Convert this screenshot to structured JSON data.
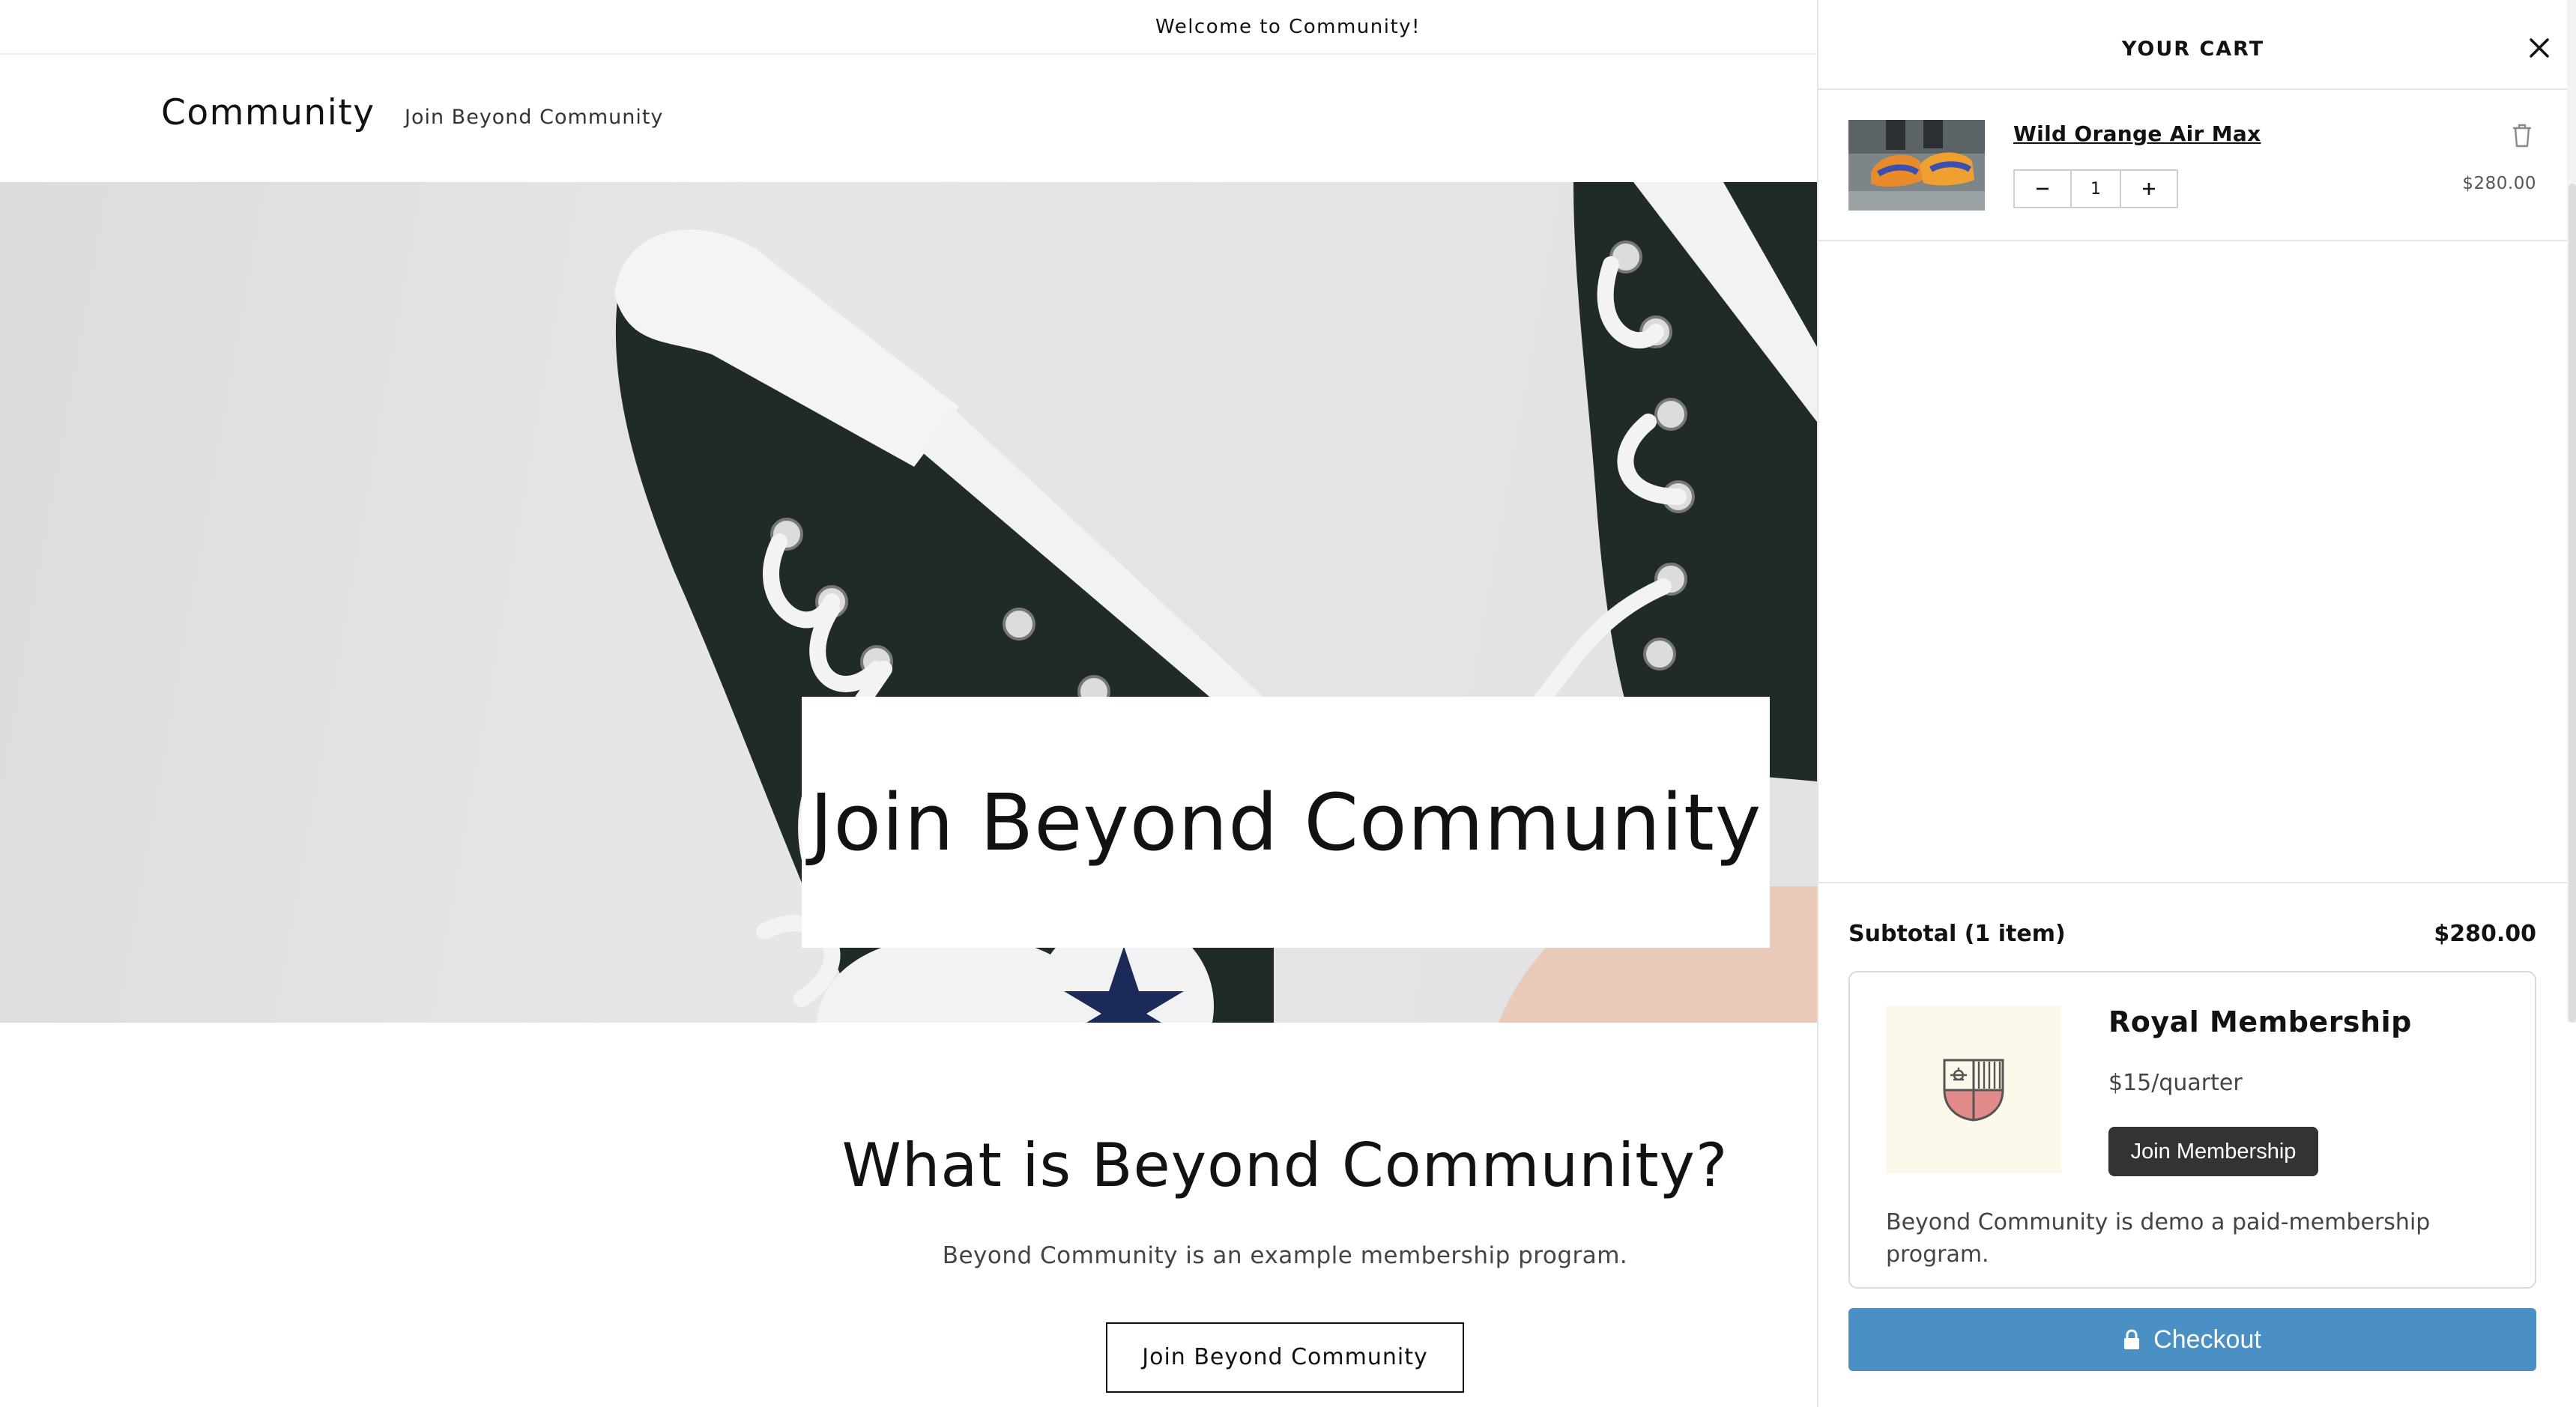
{
  "announcement": {
    "text": "Welcome to Community!"
  },
  "header": {
    "logo": "Community",
    "nav": [
      {
        "label": "Join Beyond Community"
      }
    ]
  },
  "hero": {
    "title": "Join Beyond Community"
  },
  "about": {
    "title": "What is Beyond Community?",
    "text": "Beyond Community is an example membership program.",
    "button_label": "Join Beyond Community"
  },
  "cart": {
    "title": "YOUR CART",
    "items": [
      {
        "name": "Wild Orange Air Max",
        "quantity": "1",
        "price": "$280.00"
      }
    ],
    "subtotal_label": "Subtotal (1 item)",
    "subtotal_value": "$280.00",
    "membership": {
      "title": "Royal Membership",
      "price": "$15/quarter",
      "button_label": "Join Membership",
      "description": "Beyond Community is demo a paid-membership program."
    },
    "checkout_label": "Checkout"
  },
  "colors": {
    "checkout_button": "#4a90c4",
    "membership_button": "#333333",
    "membership_image_bg": "#fcf9ea",
    "crest_red": "#e38a8a"
  }
}
